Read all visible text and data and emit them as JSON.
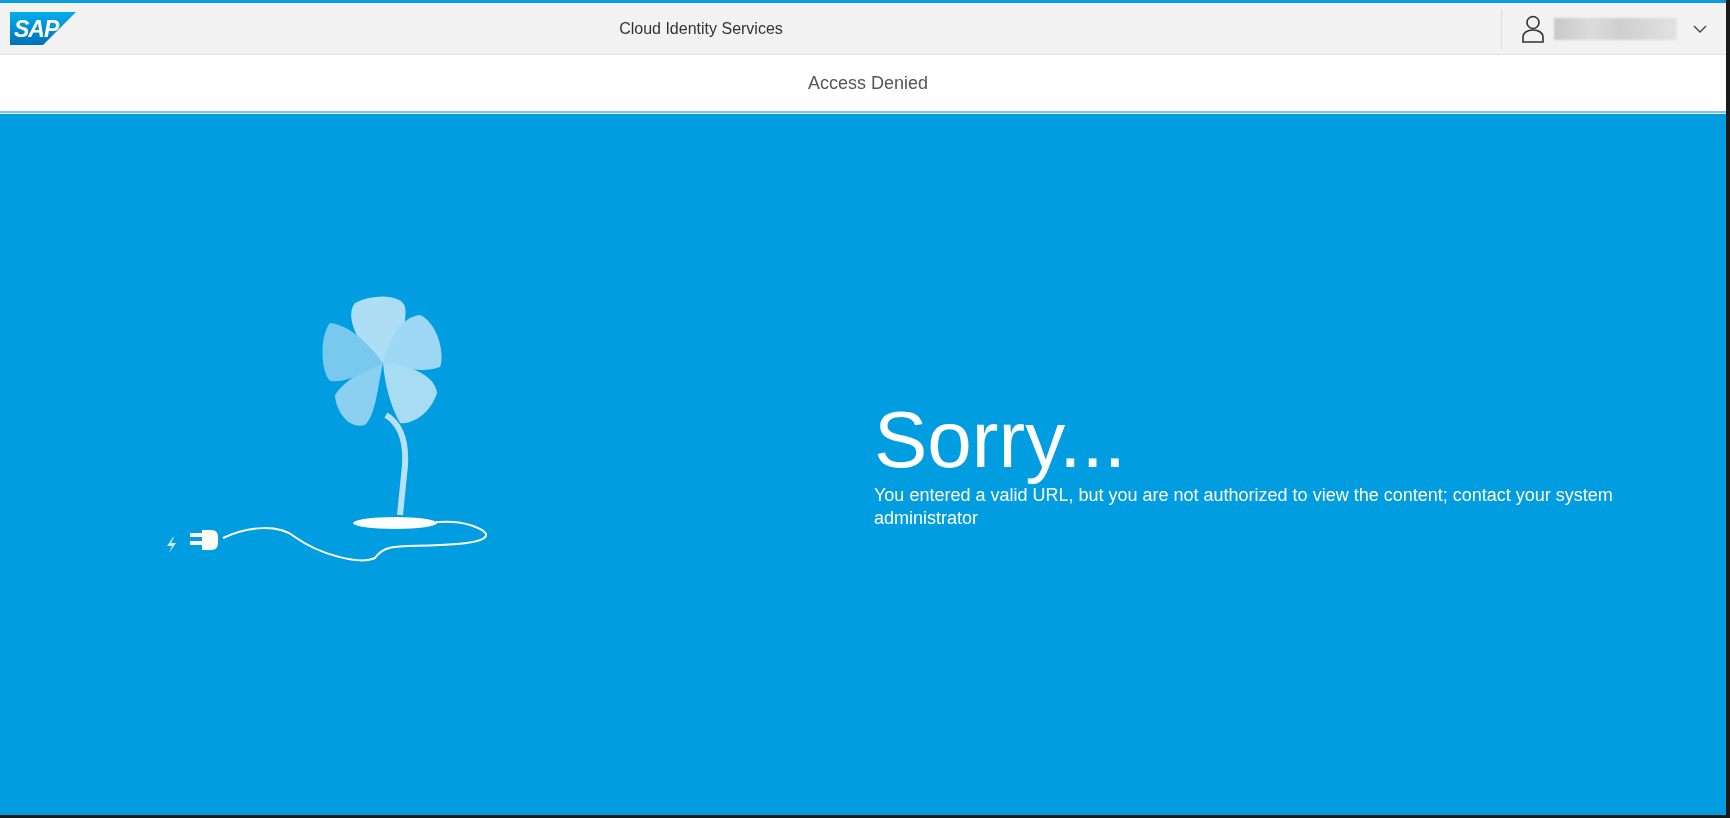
{
  "shell": {
    "logo": "SAP",
    "title": "Cloud Identity Services"
  },
  "page": {
    "title": "Access Denied"
  },
  "message": {
    "heading": "Sorry...",
    "text": "You entered a valid URL, but you are not authorized to view the content; contact your system administrator"
  }
}
